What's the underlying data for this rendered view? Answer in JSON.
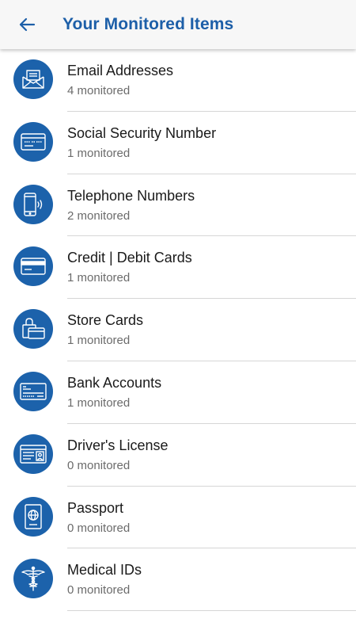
{
  "header": {
    "title": "Your Monitored Items",
    "back_icon": "arrow-left-icon",
    "accent_color": "#1d5fa8"
  },
  "items": [
    {
      "label": "Email Addresses",
      "count_text": "4 monitored",
      "icon": "envelope-icon"
    },
    {
      "label": "Social Security Number",
      "count_text": "1 monitored",
      "icon": "ssn-card-icon"
    },
    {
      "label": "Telephone Numbers",
      "count_text": "2 monitored",
      "icon": "phone-icon"
    },
    {
      "label": "Credit | Debit Cards",
      "count_text": "1 monitored",
      "icon": "credit-card-icon"
    },
    {
      "label": "Store Cards",
      "count_text": "1 monitored",
      "icon": "store-card-icon"
    },
    {
      "label": "Bank Accounts",
      "count_text": "1 monitored",
      "icon": "bank-check-icon"
    },
    {
      "label": "Driver's License",
      "count_text": "0 monitored",
      "icon": "license-icon"
    },
    {
      "label": "Passport",
      "count_text": "0 monitored",
      "icon": "passport-icon"
    },
    {
      "label": "Medical IDs",
      "count_text": "0 monitored",
      "icon": "caduceus-icon"
    }
  ],
  "colors": {
    "icon_background": "#1c62ab",
    "title_text": "#1a1a1a",
    "subtitle_text": "#6b6b6b",
    "divider": "#d6d6d6"
  }
}
